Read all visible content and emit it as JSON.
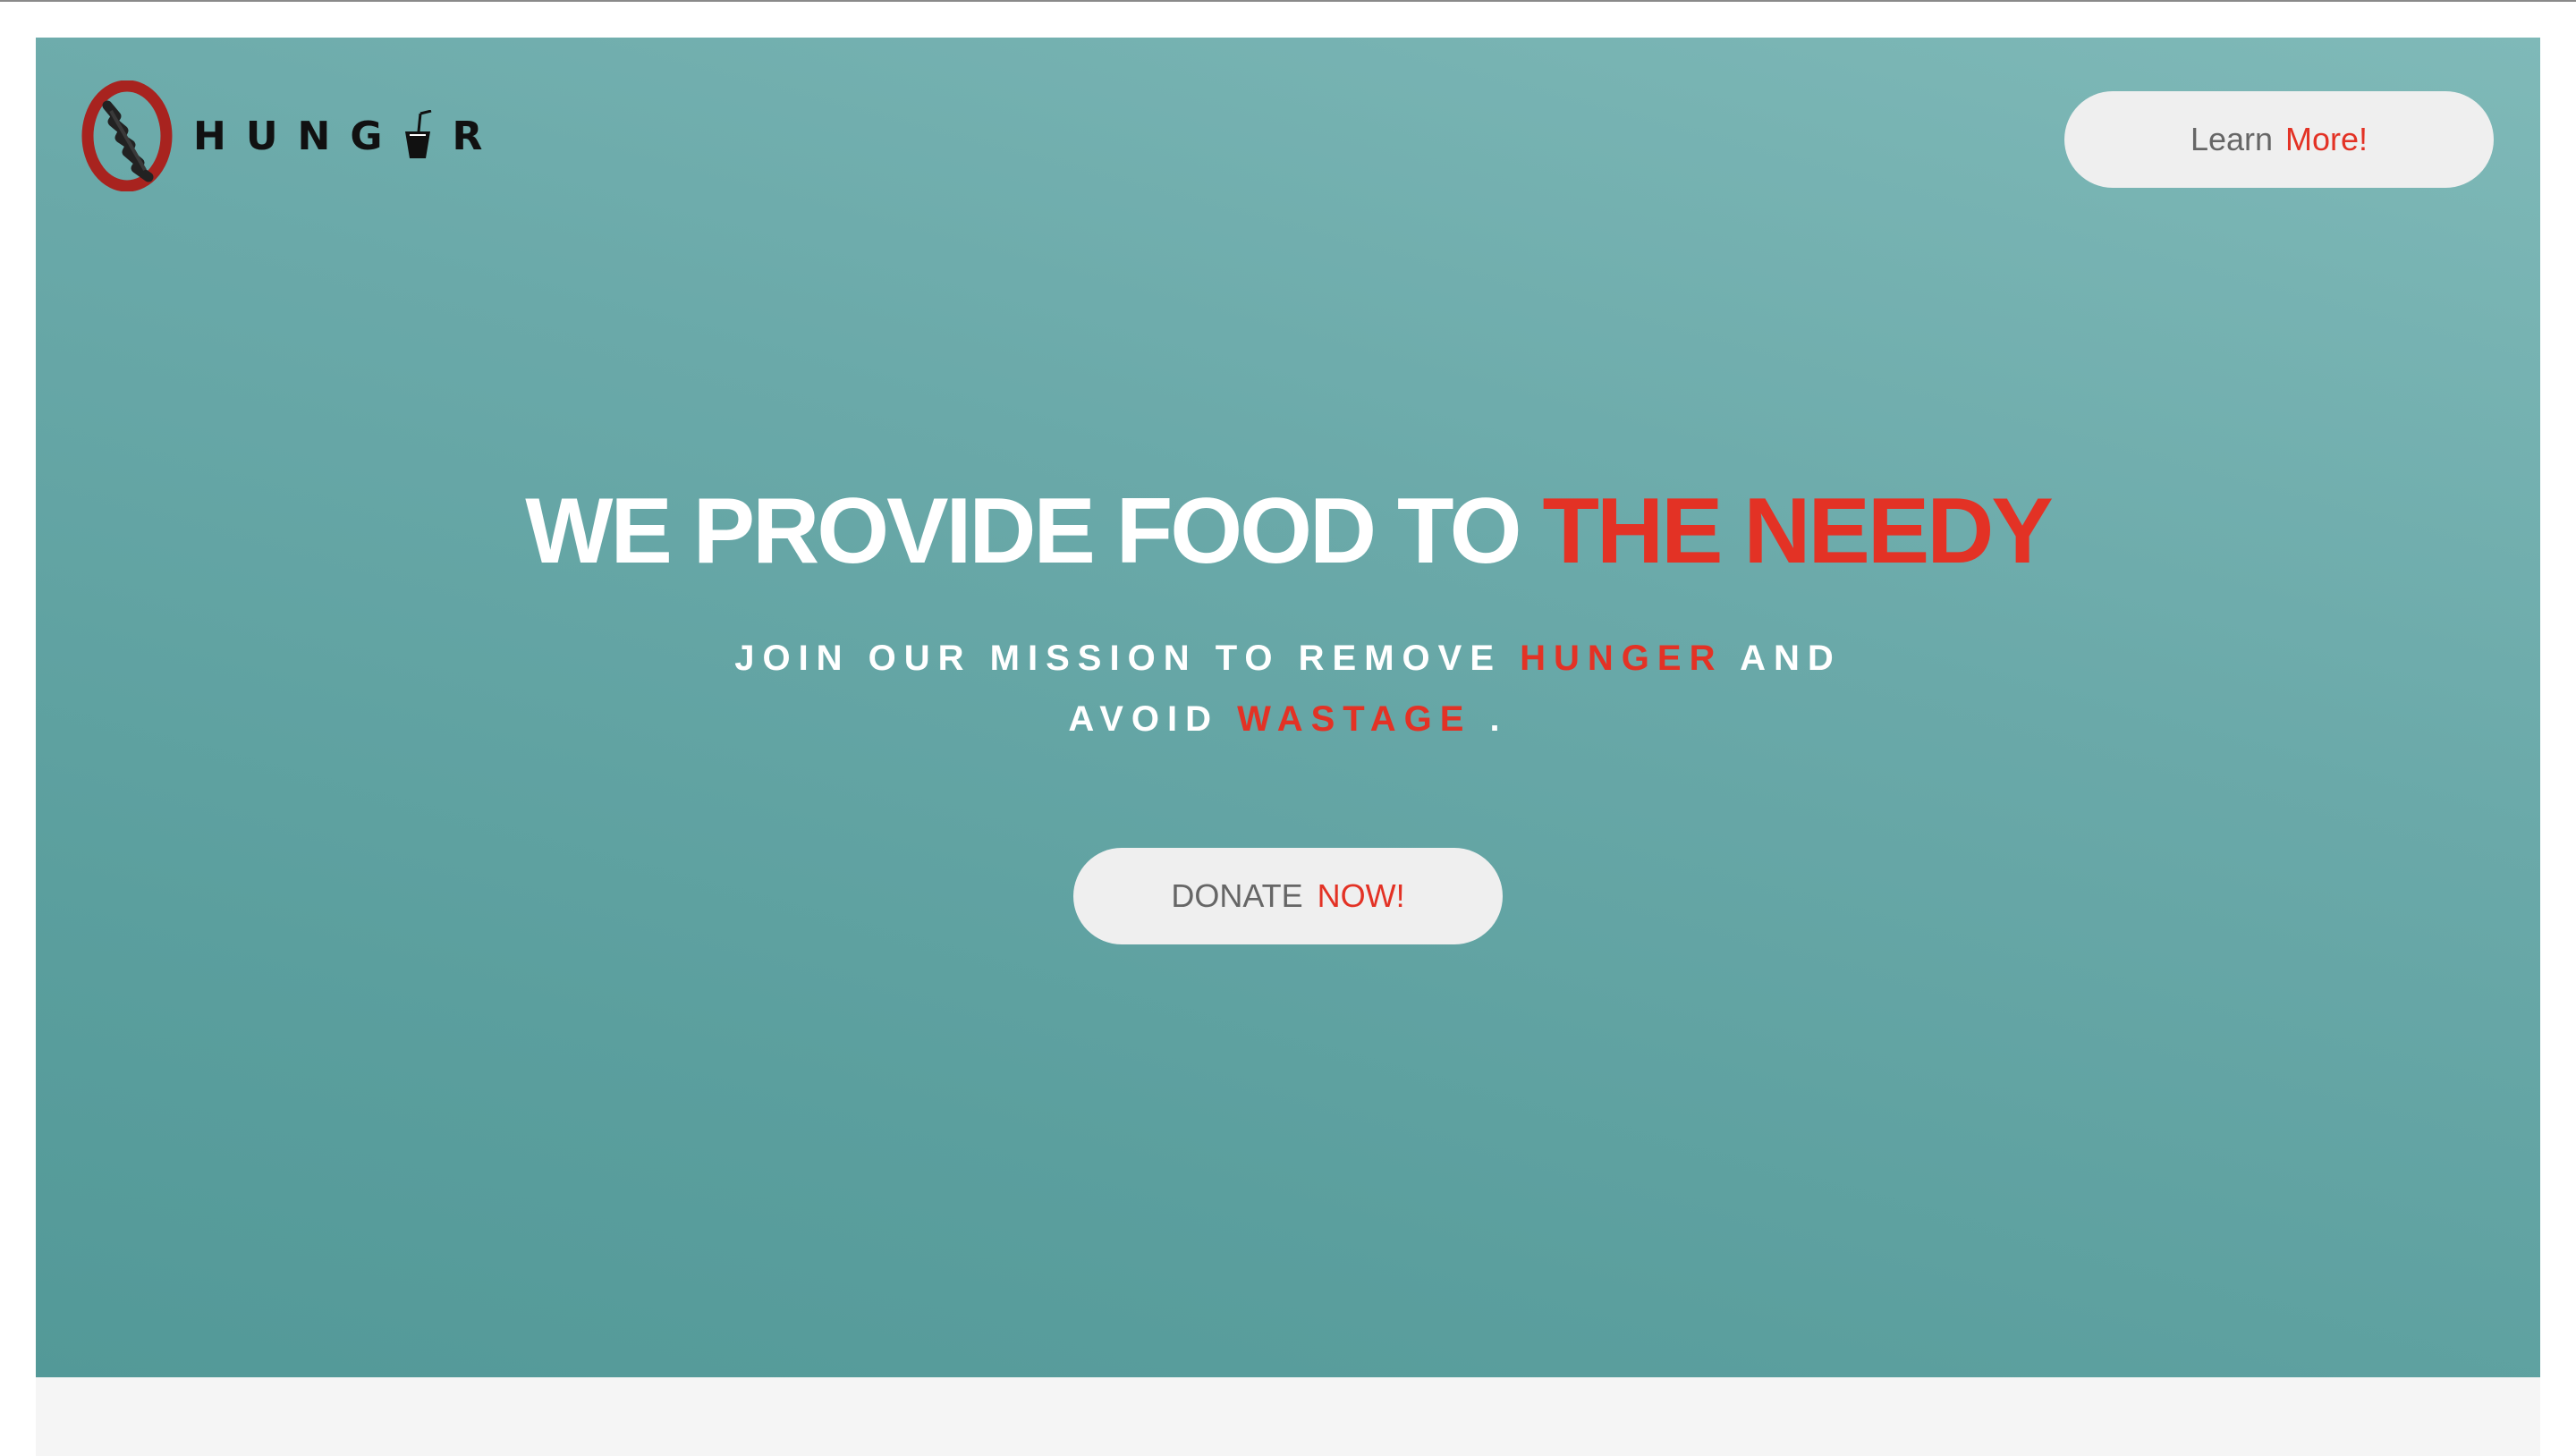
{
  "colors": {
    "hero_gradient_light": "#7fb9b8",
    "hero_gradient_dark": "#539998",
    "accent_red": "#e33225",
    "button_bg": "#efefef",
    "button_text": "#666666",
    "logo_ring": "#a8231f"
  },
  "header": {
    "logo_icon": "no-hunger-logo-icon",
    "logo_text_left": "HUNG",
    "logo_text_right": "R",
    "logo_cup_icon": "drink-cup-icon",
    "learn_button": {
      "label": "Learn",
      "accent": "More!"
    }
  },
  "hero": {
    "headline_main": "WE PROVIDE FOOD TO",
    "headline_accent": "THE NEEDY",
    "subline_1_a": "JOIN OUR MISSION TO REMOVE",
    "subline_1_accent": "HUNGER",
    "subline_1_b": "AND",
    "subline_2_a": "AVOID",
    "subline_2_accent": "WASTAGE",
    "subline_2_b": ".",
    "donate_button": {
      "label": "DONATE",
      "accent": "NOW!"
    }
  }
}
